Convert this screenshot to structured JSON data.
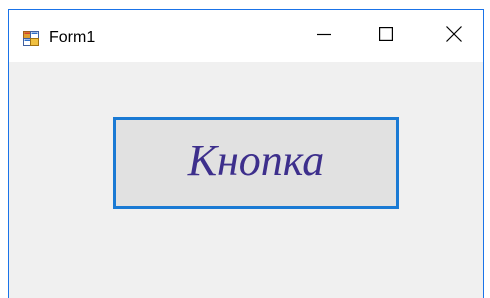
{
  "window": {
    "title": "Form1",
    "icon": "winforms-app-icon"
  },
  "title_bar": {
    "minimize_icon": "minimize-icon",
    "maximize_icon": "maximize-icon",
    "close_icon": "close-icon"
  },
  "form": {
    "button_label": "Кнопка",
    "button_text_color": "#3d2f8c",
    "button_border_color": "#1a7ad4",
    "background_color": "#f0f0f0"
  }
}
